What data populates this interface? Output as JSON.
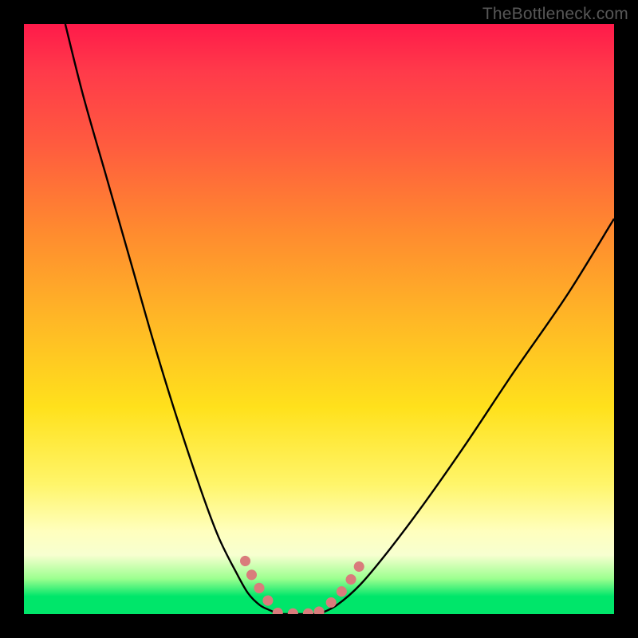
{
  "watermark": "TheBottleneck.com",
  "colors": {
    "frame_bg": "#000000",
    "curve_stroke": "#000000",
    "highlight_stroke": "#d97c7c"
  },
  "chart_data": {
    "type": "line",
    "title": "",
    "xlabel": "",
    "ylabel": "",
    "xlim": [
      0,
      100
    ],
    "ylim": [
      0,
      100
    ],
    "series": [
      {
        "name": "left-curve",
        "x": [
          7,
          10,
          14,
          18,
          22,
          26,
          30,
          33,
          36,
          38,
          40,
          42,
          43
        ],
        "y": [
          100,
          88,
          74,
          60,
          46,
          33,
          21,
          13,
          7,
          3.5,
          1.5,
          0.5,
          0
        ]
      },
      {
        "name": "valley-floor",
        "x": [
          43,
          47,
          50
        ],
        "y": [
          0,
          0,
          0
        ]
      },
      {
        "name": "right-curve",
        "x": [
          50,
          53,
          57,
          62,
          68,
          75,
          83,
          92,
          100
        ],
        "y": [
          0,
          1.5,
          5,
          11,
          19,
          29,
          41,
          54,
          67
        ]
      },
      {
        "name": "highlight-left",
        "x": [
          37.5,
          38.5,
          39.5,
          40.5,
          41.5,
          42.5,
          43.0
        ],
        "y": [
          9.0,
          6.8,
          5.0,
          3.4,
          2.1,
          1.0,
          0.4
        ]
      },
      {
        "name": "highlight-floor",
        "x": [
          43,
          45,
          47,
          49,
          50
        ],
        "y": [
          0.2,
          0.1,
          0.1,
          0.1,
          0.2
        ]
      },
      {
        "name": "highlight-right",
        "x": [
          50.0,
          51.0,
          52.0,
          53.2,
          54.5,
          55.8,
          57.0
        ],
        "y": [
          0.4,
          1.0,
          1.9,
          3.1,
          4.6,
          6.4,
          8.4
        ]
      }
    ]
  }
}
